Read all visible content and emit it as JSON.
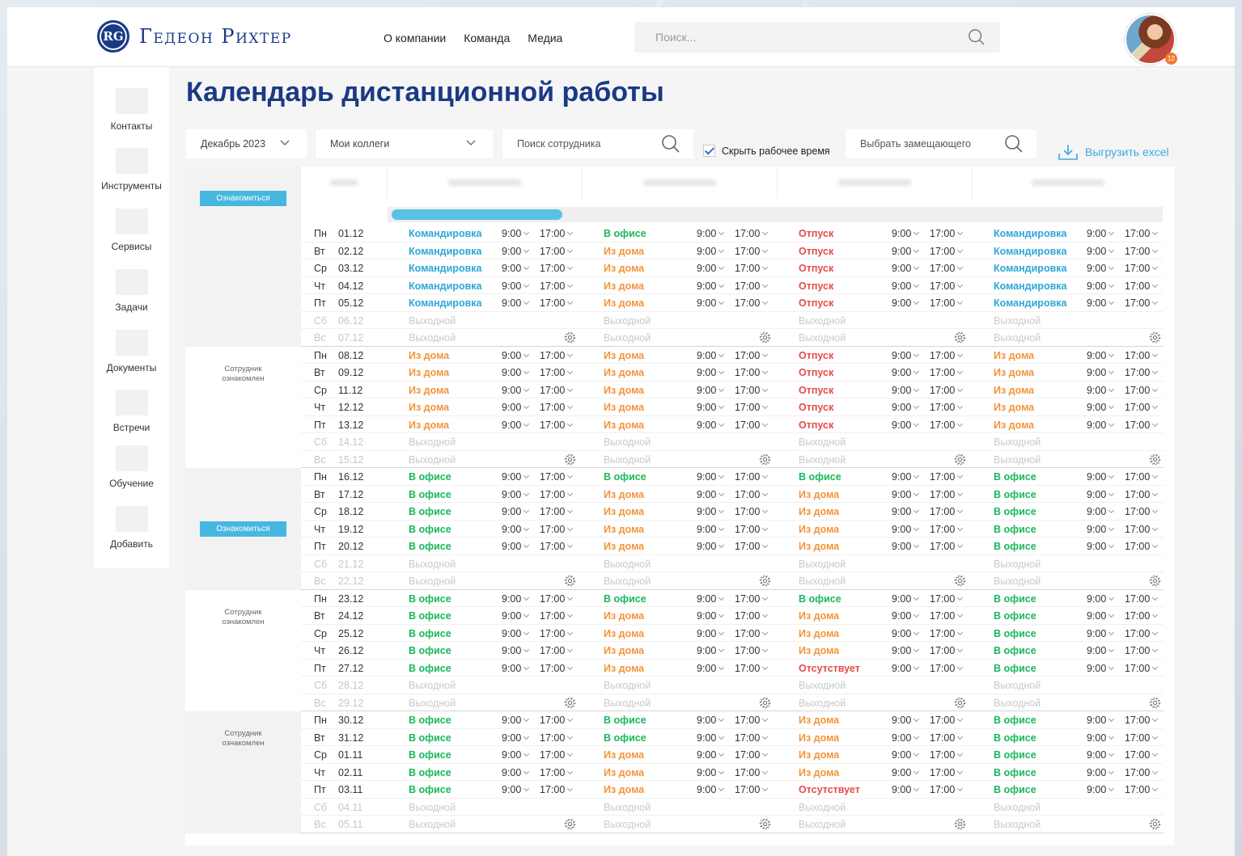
{
  "header": {
    "logo_initials": "RG",
    "logo_text": "Гедеон Рихтер",
    "nav": [
      "О компании",
      "Команда",
      "Медиа"
    ],
    "search_placeholder": "Поиск...",
    "avatar_badge": "12"
  },
  "sidebar": {
    "items": [
      "Контакты",
      "Инструменты",
      "Сервисы",
      "Задачи",
      "Документы",
      "Встречи",
      "Обучение",
      "Добавить"
    ]
  },
  "page_title": "Календарь дистанционной работы",
  "filters": {
    "month": "Декабрь 2023",
    "group": "Мои коллеги",
    "employee_search_placeholder": "Поиск сотрудника",
    "hide_work_time": "Скрыть рабочее время",
    "hide_work_time_checked": true,
    "substitute_placeholder": "Выбрать замещающего",
    "export": "Выгрузить excel"
  },
  "ack": {
    "button": "Ознакомиться",
    "acknowledged": "Сотрудник ознакомлен"
  },
  "progress_fraction": 0.22,
  "time_from": "9:00",
  "time_to": "17:00",
  "weekend_label": "Выходной",
  "colors": {
    "brand": "#1a3a85",
    "accent": "#46b8e0",
    "trip": "#2ea6d6",
    "office": "#18b85c",
    "home": "#f3943a",
    "vacation": "#e64b45"
  },
  "weeks": [
    {
      "ack_state": "button",
      "days": [
        {
          "dow": "Пн",
          "date": "01.12",
          "statuses": [
            "Командировка",
            "В офисе",
            "Отпуск",
            "Командировка"
          ]
        },
        {
          "dow": "Вт",
          "date": "02.12",
          "statuses": [
            "Командировка",
            "Из дома",
            "Отпуск",
            "Командировка"
          ]
        },
        {
          "dow": "Ср",
          "date": "03.12",
          "statuses": [
            "Командировка",
            "Из дома",
            "Отпуск",
            "Командировка"
          ]
        },
        {
          "dow": "Чт",
          "date": "04.12",
          "statuses": [
            "Командировка",
            "Из дома",
            "Отпуск",
            "Командировка"
          ]
        },
        {
          "dow": "Пт",
          "date": "05.12",
          "statuses": [
            "Командировка",
            "Из дома",
            "Отпуск",
            "Командировка"
          ]
        },
        {
          "dow": "Сб",
          "date": "06.12",
          "off": true
        },
        {
          "dow": "Вс",
          "date": "07.12",
          "off": true
        }
      ]
    },
    {
      "ack_state": "text",
      "days": [
        {
          "dow": "Пн",
          "date": "08.12",
          "statuses": [
            "Из дома",
            "Из дома",
            "Отпуск",
            "Из дома"
          ]
        },
        {
          "dow": "Вт",
          "date": "09.12",
          "statuses": [
            "Из дома",
            "Из дома",
            "Отпуск",
            "Из дома"
          ]
        },
        {
          "dow": "Ср",
          "date": "11.12",
          "statuses": [
            "Из дома",
            "Из дома",
            "Отпуск",
            "Из дома"
          ]
        },
        {
          "dow": "Чт",
          "date": "12.12",
          "statuses": [
            "Из дома",
            "Из дома",
            "Отпуск",
            "Из дома"
          ]
        },
        {
          "dow": "Пт",
          "date": "13.12",
          "statuses": [
            "Из дома",
            "Из дома",
            "Отпуск",
            "Из дома"
          ]
        },
        {
          "dow": "Сб",
          "date": "14.12",
          "off": true
        },
        {
          "dow": "Вс",
          "date": "15.12",
          "off": true
        }
      ]
    },
    {
      "ack_state": "button",
      "days": [
        {
          "dow": "Пн",
          "date": "16.12",
          "statuses": [
            "В офисе",
            "В офисе",
            "В офисе",
            "В офисе"
          ]
        },
        {
          "dow": "Вт",
          "date": "17.12",
          "statuses": [
            "В офисе",
            "Из дома",
            "Из дома",
            "В офисе"
          ]
        },
        {
          "dow": "Ср",
          "date": "18.12",
          "statuses": [
            "В офисе",
            "Из дома",
            "Из дома",
            "В офисе"
          ]
        },
        {
          "dow": "Чт",
          "date": "19.12",
          "statuses": [
            "В офисе",
            "Из дома",
            "Из дома",
            "В офисе"
          ]
        },
        {
          "dow": "Пт",
          "date": "20.12",
          "statuses": [
            "В офисе",
            "Из дома",
            "Из дома",
            "В офисе"
          ]
        },
        {
          "dow": "Сб",
          "date": "21.12",
          "off": true
        },
        {
          "dow": "Вс",
          "date": "22.12",
          "off": true
        }
      ]
    },
    {
      "ack_state": "text",
      "days": [
        {
          "dow": "Пн",
          "date": "23.12",
          "statuses": [
            "В офисе",
            "В офисе",
            "В офисе",
            "В офисе"
          ]
        },
        {
          "dow": "Вт",
          "date": "24.12",
          "statuses": [
            "В офисе",
            "Из дома",
            "Из дома",
            "В офисе"
          ]
        },
        {
          "dow": "Ср",
          "date": "25.12",
          "statuses": [
            "В офисе",
            "Из дома",
            "Из дома",
            "В офисе"
          ]
        },
        {
          "dow": "Чт",
          "date": "26.12",
          "statuses": [
            "В офисе",
            "Из дома",
            "Из дома",
            "В офисе"
          ]
        },
        {
          "dow": "Пт",
          "date": "27.12",
          "statuses": [
            "В офисе",
            "Из дома",
            "Отсутствует",
            "В офисе"
          ]
        },
        {
          "dow": "Сб",
          "date": "28.12",
          "off": true
        },
        {
          "dow": "Вс",
          "date": "29.12",
          "off": true
        }
      ]
    },
    {
      "ack_state": "text",
      "days": [
        {
          "dow": "Пн",
          "date": "30.12",
          "statuses": [
            "В офисе",
            "В офисе",
            "Из дома",
            "В офисе"
          ]
        },
        {
          "dow": "Вт",
          "date": "31.12",
          "statuses": [
            "В офисе",
            "В офисе",
            "Из дома",
            "В офисе"
          ]
        },
        {
          "dow": "Ср",
          "date": "01.11",
          "statuses": [
            "В офисе",
            "Из дома",
            "Из дома",
            "В офисе"
          ]
        },
        {
          "dow": "Чт",
          "date": "02.11",
          "statuses": [
            "В офисе",
            "Из дома",
            "Из дома",
            "В офисе"
          ]
        },
        {
          "dow": "Пт",
          "date": "03.11",
          "statuses": [
            "В офисе",
            "Из дома",
            "Отсутствует",
            "В офисе"
          ]
        },
        {
          "dow": "Сб",
          "date": "04.11",
          "off": true
        },
        {
          "dow": "Вс",
          "date": "05.11",
          "off": true
        }
      ]
    }
  ]
}
